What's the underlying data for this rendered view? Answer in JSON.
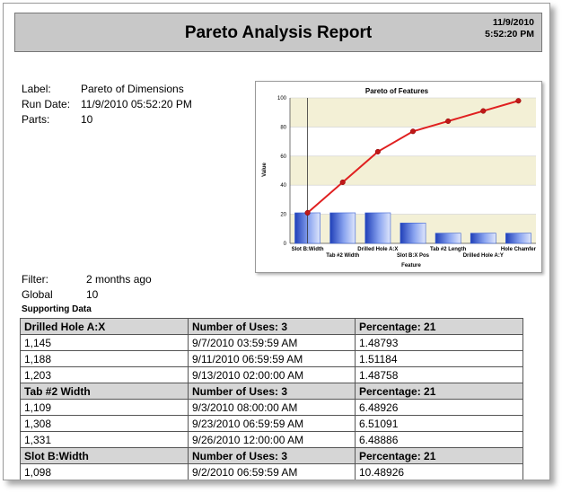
{
  "report": {
    "title": "Pareto Analysis Report",
    "date": "11/9/2010",
    "time": "5:52:20 PM"
  },
  "meta": {
    "label_key": "Label:",
    "label_val": "Pareto of Dimensions",
    "rundate_key": "Run Date:",
    "rundate_val": "11/9/2010 05:52:20 PM",
    "parts_key": "Parts:",
    "parts_val": "10",
    "filter_key": "Filter:",
    "filter_val": "2 months ago",
    "global_key": "Global",
    "global_val": "10"
  },
  "supporting_label": "Supporting Data",
  "groups": [
    {
      "name": "Drilled Hole A:X",
      "uses": "Number of Uses: 3",
      "pct": "Percentage: 21",
      "rows": [
        [
          "1,145",
          "9/7/2010 03:59:59 AM",
          "1.48793"
        ],
        [
          "1,188",
          "9/11/2010 06:59:59 AM",
          "1.51184"
        ],
        [
          "1,203",
          "9/13/2010 02:00:00 AM",
          "1.48758"
        ]
      ]
    },
    {
      "name": "Tab #2 Width",
      "uses": "Number of Uses: 3",
      "pct": "Percentage: 21",
      "rows": [
        [
          "1,109",
          "9/3/2010 08:00:00 AM",
          "6.48926"
        ],
        [
          "1,308",
          "9/23/2010 06:59:59 AM",
          "6.51091"
        ],
        [
          "1,331",
          "9/26/2010 12:00:00 AM",
          "6.48886"
        ]
      ]
    },
    {
      "name": "Slot B:Width",
      "uses": "Number of Uses: 3",
      "pct": "Percentage: 21",
      "rows": [
        [
          "1,098",
          "9/2/2010 06:59:59 AM",
          "10.48926"
        ]
      ]
    }
  ],
  "chart_data": {
    "type": "bar",
    "title": "Pareto of Features",
    "xlabel": "Feature",
    "ylabel": "Value",
    "ylim": [
      0,
      100
    ],
    "yticks": [
      0,
      20,
      40,
      60,
      80,
      100
    ],
    "categories": [
      "Slot B:Width",
      "Tab #2 Width",
      "Drilled Hole A:X",
      "Slot B:X Pos",
      "Tab #2 Length",
      "Drilled Hole A:Y",
      "Hole Chamfer"
    ],
    "values": [
      21,
      21,
      21,
      14,
      7,
      7,
      7
    ],
    "cumulative": [
      21,
      42,
      63,
      77,
      84,
      91,
      98
    ],
    "bar_color": "#3a5fd0",
    "line_color": "#e02020",
    "band_color": "#f3f0d6"
  }
}
